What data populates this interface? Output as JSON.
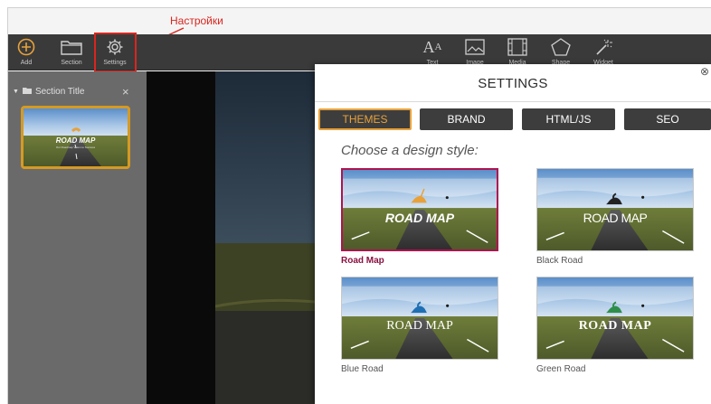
{
  "annotation": {
    "label": "Настройки"
  },
  "toolbar": {
    "left": [
      {
        "label": "Add",
        "icon": "plus-circle-icon"
      },
      {
        "label": "Section",
        "icon": "folder-icon"
      },
      {
        "label": "Settings",
        "icon": "gear-icon"
      }
    ],
    "right": [
      {
        "label": "Text",
        "icon": "text-icon"
      },
      {
        "label": "Image",
        "icon": "image-icon"
      },
      {
        "label": "Media",
        "icon": "media-icon"
      },
      {
        "label": "Shape",
        "icon": "pentagon-icon"
      },
      {
        "label": "Widget",
        "icon": "magic-wand-icon"
      }
    ]
  },
  "sidebar": {
    "section_title": "Section Title",
    "thumbnail": {
      "title": "ROAD MAP",
      "subtitle": "Our Roadmap Vision to Success"
    }
  },
  "settings": {
    "title": "SETTINGS",
    "tabs": [
      "THEMES",
      "BRAND",
      "HTML/JS",
      "SEO"
    ],
    "active_tab": "THEMES",
    "prompt": "Choose a design style:",
    "styles": [
      {
        "name": "Road Map",
        "banner": "ROAD MAP",
        "accent": "#e8a13a",
        "selected": true
      },
      {
        "name": "Black Road",
        "banner": "ROAD MAP",
        "accent": "#222222",
        "selected": false
      },
      {
        "name": "Blue Road",
        "banner": "ROAD MAP",
        "accent": "#1f6fb3",
        "selected": false
      },
      {
        "name": "Green Road",
        "banner": "ROAD MAP",
        "accent": "#2f8f4a",
        "selected": false
      }
    ]
  },
  "colors": {
    "highlight": "#d8261f",
    "active_tab": "#e8a13a",
    "selected_card": "#b0124f",
    "toolbar_bg": "#3a3a3a"
  }
}
